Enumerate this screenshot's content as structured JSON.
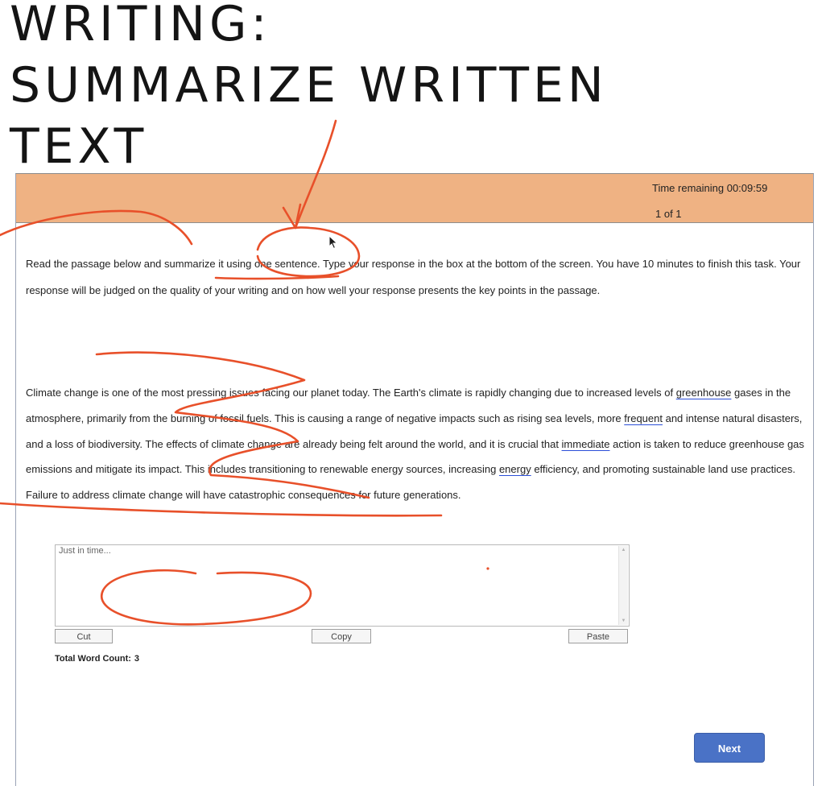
{
  "slide": {
    "title_lines": [
      "WRITING:",
      "SUMMARIZE WRITTEN",
      "TEXT"
    ]
  },
  "test": {
    "header": {
      "timer": "Time remaining 00:09:59",
      "pager": "1 of 1",
      "color": "#efb283"
    },
    "instruction": "Read the passage below and summarize it using one sentence. Type your response in the box at the bottom of the screen. You have 10 minutes to finish this task. Your response will be judged on the quality of your writing and on how well your response presents the key points in the passage.",
    "passage": {
      "p1": "Climate change is one of the most pressing issues facing our planet today. The Earth's climate is rapidly changing due to increased levels of ",
      "u1": "greenhouse",
      "p2": " gases in the atmosphere, primarily from the burning of fossil fuels. This is causing a range of negative impacts such as rising sea levels, more ",
      "u2": "frequent",
      "p3": " and intense natural disasters, and a loss of biodiversity. The effects of climate change are already being felt around the world, and it is crucial that ",
      "u3": "immediate",
      "p4": " action is taken to reduce greenhouse gas emissions and mitigate its impact. This includes transitioning to renewable energy sources, increasing ",
      "u4": "energy",
      "p5": " efficiency, and promoting sustainable land use practices. Failure to address climate change will have catastrophic consequences for future generations."
    },
    "response": {
      "value": "Just in time...",
      "word_count_label": "Total Word Count:",
      "word_count": "3"
    },
    "buttons": {
      "cut": "Cut",
      "copy": "Copy",
      "paste": "Paste",
      "next": "Next"
    },
    "accent_color": "#4a72c6",
    "annotation_color": "#e8502a"
  }
}
